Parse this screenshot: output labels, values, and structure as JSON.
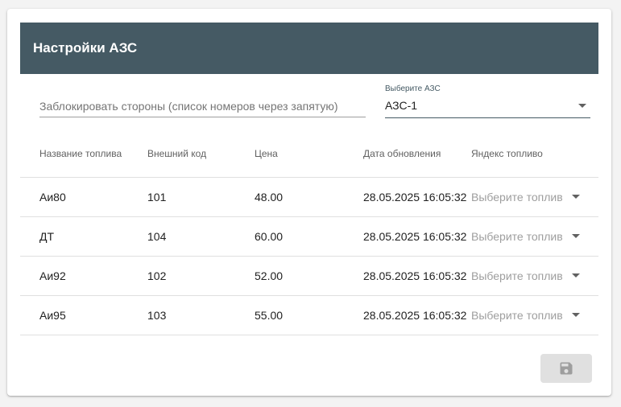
{
  "header": {
    "title": "Настройки АЗС"
  },
  "block_sides": {
    "placeholder": "Заблокировать стороны (список номеров через запятую)",
    "value": ""
  },
  "station_select": {
    "label": "Выберите АЗС",
    "value": "АЗС-1"
  },
  "table": {
    "columns": [
      "Название топлива",
      "Внешний код",
      "Цена",
      "Дата обновления",
      "Яндекс топливо"
    ],
    "rows": [
      {
        "name": "Аи80",
        "code": "101",
        "price": "48.00",
        "updated": "28.05.2025 16:05:32",
        "yandex": "Выберите топливо"
      },
      {
        "name": "ДТ",
        "code": "104",
        "price": "60.00",
        "updated": "28.05.2025 16:05:32",
        "yandex": "Выберите топливо"
      },
      {
        "name": "Аи92",
        "code": "102",
        "price": "52.00",
        "updated": "28.05.2025 16:05:32",
        "yandex": "Выберите топливо"
      },
      {
        "name": "Аи95",
        "code": "103",
        "price": "55.00",
        "updated": "28.05.2025 16:05:32",
        "yandex": "Выберите топливо"
      }
    ]
  },
  "save_button": {
    "icon": "floppy-disk-icon",
    "enabled": false
  },
  "colors": {
    "header_bg": "#455a64",
    "header_text": "#ffffff",
    "save_button_bg": "#e0e0e0",
    "save_icon": "#9e9e9e"
  }
}
